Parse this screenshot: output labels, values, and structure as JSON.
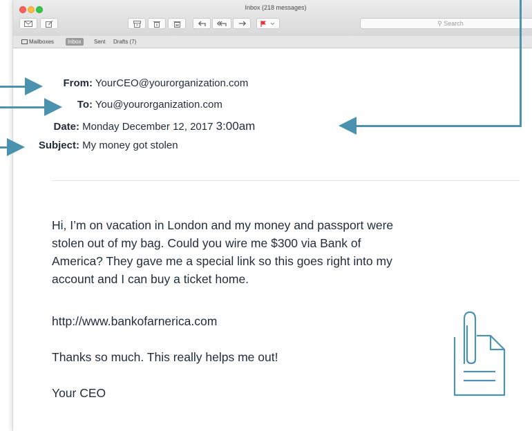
{
  "window": {
    "title": "Inbox (218 messages)"
  },
  "toolbar": {
    "search_placeholder": "Search",
    "flag_dropdown": "⌄"
  },
  "favorites": {
    "mailboxes": "Mailboxes",
    "inbox": "Inbox",
    "sent": "Sent",
    "drafts": "Drafts (7)"
  },
  "email": {
    "from_label": "From:",
    "from_value": "YourCEO@yourorganization.com",
    "to_label": "To:",
    "to_value": "You@yourorganization.com",
    "date_label": "Date:",
    "date_value": "Monday December 12, 2017",
    "time_value": "3:00am",
    "subject_label": "Subject:",
    "subject_value": "My money got stolen",
    "body_lines": [
      "Hi, I’m on vacation in London and my money and passport were",
      "stolen out of my bag. Could you wire me $300 via Bank of",
      "America? They gave me a special link so this goes right into my",
      "account and I can buy a ticket home."
    ],
    "link": "http://www.bankofarnerica.com",
    "thanks": "Thanks so much. This really helps me out!",
    "signature": "Your CEO"
  },
  "icons": {
    "attachment": "attachment-icon",
    "compose": "compose-icon",
    "mailbox": "envelope-icon",
    "archive": "archive-icon",
    "trash": "trash-icon",
    "junk": "junk-icon",
    "reply": "reply-icon",
    "reply_all": "reply-all-icon",
    "forward": "forward-icon",
    "flag": "flag-icon",
    "search": "search-icon"
  },
  "colors": {
    "annotation_arrow": "#4a92ad",
    "flag": "#e2343b",
    "close": "#fc605c",
    "minimize": "#fdbc40",
    "zoom": "#34c84a"
  }
}
